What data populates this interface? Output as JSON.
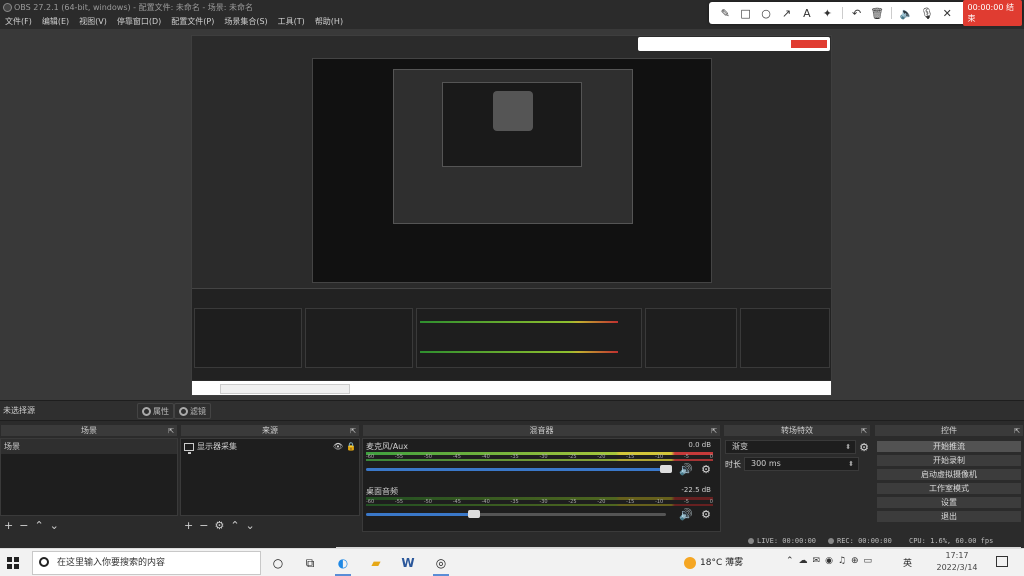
{
  "window": {
    "title": "OBS 27.2.1 (64-bit, windows) - 配置文件: 未命名 - 场景: 未命名"
  },
  "menu": [
    "文件(F)",
    "编辑(E)",
    "视图(V)",
    "停靠窗口(D)",
    "配置文件(P)",
    "场景集合(S)",
    "工具(T)",
    "帮助(H)"
  ],
  "screen_tool": {
    "icons": [
      "pencil-icon",
      "rectangle-icon",
      "circle-icon",
      "arrow-icon",
      "text-icon",
      "marker-icon",
      "undo-icon",
      "trash-icon",
      "speaker-icon",
      "mic-icon",
      "close-icon"
    ],
    "record_time": "00:00:00 结束",
    "accent": "#e03c31"
  },
  "status": {
    "no_selection": "未选择源",
    "properties": "属性",
    "filters": "滤镜"
  },
  "scenes": {
    "title": "场景",
    "items": [
      "场景"
    ]
  },
  "sources": {
    "title": "来源",
    "items": [
      {
        "label": "显示器采集",
        "icon": "monitor-icon"
      }
    ]
  },
  "mixer": {
    "title": "混音器",
    "ticks": [
      "-60",
      "-55",
      "-50",
      "-45",
      "-40",
      "-35",
      "-30",
      "-25",
      "-20",
      "-15",
      "-10",
      "-5",
      "0"
    ],
    "channels": [
      {
        "name": "麦克风/Aux",
        "db": "0.0 dB",
        "level": 0.95,
        "volume": 1.0
      },
      {
        "name": "桌面音频",
        "db": "-22.5 dB",
        "level": 0.0,
        "volume": 0.35
      }
    ]
  },
  "transitions": {
    "title": "转场特效",
    "selected": "渐变",
    "duration_label": "时长",
    "duration": "300 ms"
  },
  "controls": {
    "title": "控件",
    "buttons": [
      "开始推流",
      "开始录制",
      "启动虚拟摄像机",
      "工作室模式",
      "设置",
      "退出"
    ]
  },
  "bottom_status": {
    "live": "LIVE: 00:00:00",
    "rec": "REC: 00:00:00",
    "cpu": "CPU: 1.6%, 60.00 fps"
  },
  "taskbar": {
    "search_placeholder": "在这里输入你要搜索的内容",
    "weather": "18°C 薄雾",
    "ime": "英",
    "time": "17:17",
    "date": "2022/3/14"
  }
}
